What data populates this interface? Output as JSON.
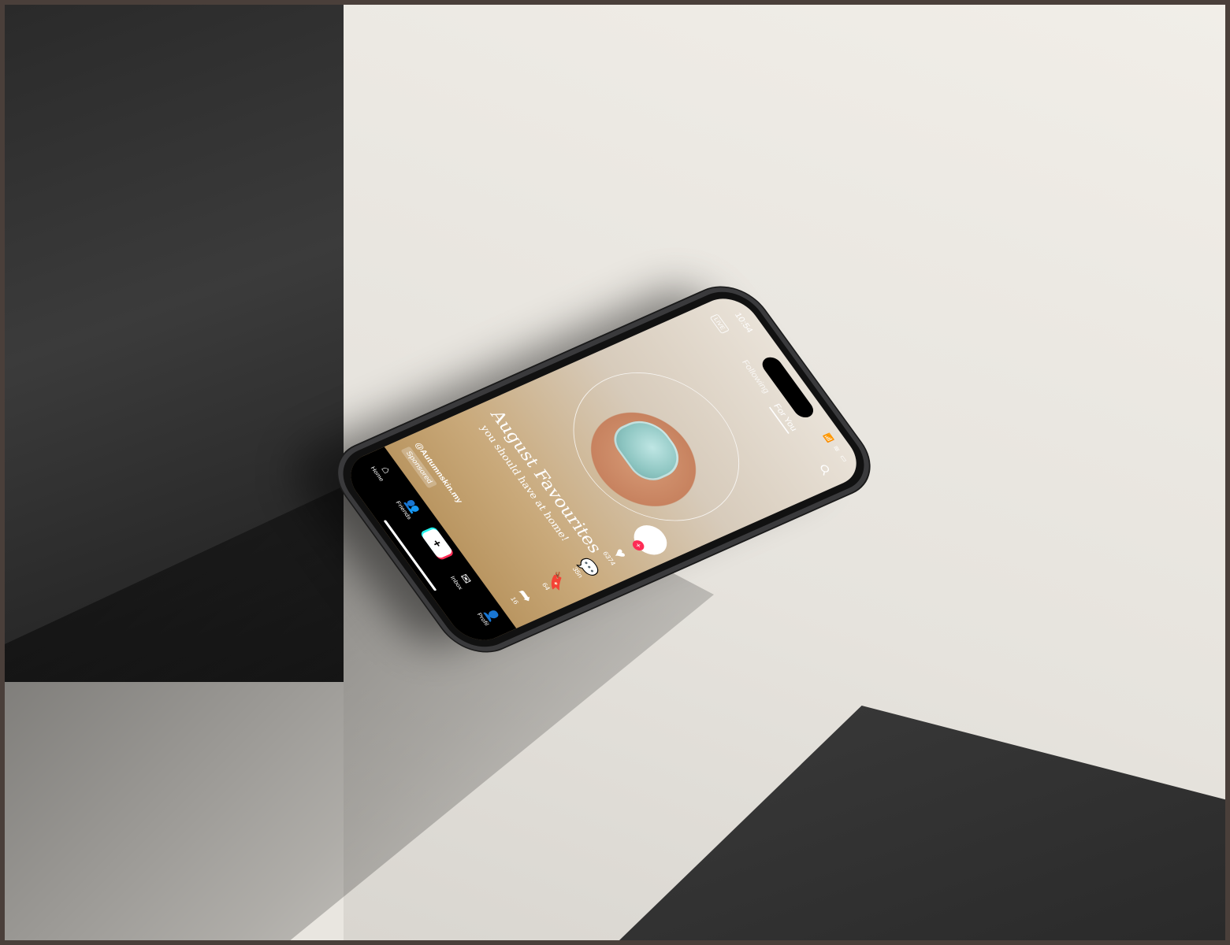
{
  "status_bar": {
    "time": "10:54",
    "icons": "📶 ≋ ▭"
  },
  "top": {
    "live_label": "LIVE",
    "tabs": [
      {
        "label": "Following"
      },
      {
        "label": "For You"
      }
    ]
  },
  "video": {
    "headline": "August Favourites",
    "subline": "you should have at home!",
    "handle": "@Autumnskin.my",
    "sponsored": "Sponsored"
  },
  "rail": {
    "likes": "6374",
    "comments": "35n",
    "saves": "64",
    "shares": "16"
  },
  "nav": {
    "home": "Home",
    "friends": "Friends",
    "create": "+",
    "inbox": "Inbox",
    "profile": "Profil"
  },
  "colors": {
    "accent_red": "#fe2c55",
    "accent_cyan": "#25f4ee"
  }
}
